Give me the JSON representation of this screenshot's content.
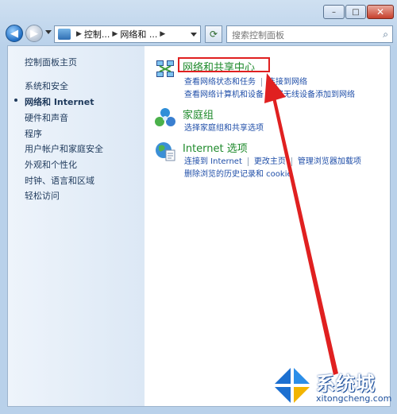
{
  "window": {
    "controls": {
      "minimize": "–",
      "maximize": "□",
      "close": "✕"
    }
  },
  "toolbar": {
    "back_glyph": "◀",
    "forward_glyph": "▶",
    "address": {
      "segments": [
        "控制...",
        "网络和 ..."
      ]
    },
    "refresh_glyph": "⟳",
    "search": {
      "placeholder": "搜索控制面板",
      "icon": "search-icon"
    }
  },
  "sidebar": {
    "home": "控制面板主页",
    "items": [
      {
        "label": "系统和安全",
        "active": false
      },
      {
        "label": "网络和 Internet",
        "active": true
      },
      {
        "label": "硬件和声音",
        "active": false
      },
      {
        "label": "程序",
        "active": false
      },
      {
        "label": "用户帐户和家庭安全",
        "active": false
      },
      {
        "label": "外观和个性化",
        "active": false
      },
      {
        "label": "时钟、语言和区域",
        "active": false
      },
      {
        "label": "轻松访问",
        "active": false
      }
    ]
  },
  "categories": [
    {
      "title": "网络和共享中心",
      "icon": "network-icon",
      "links_row1": [
        "查看网络状态和任务",
        "连接到网络"
      ],
      "links_row2": [
        "查看网络计算机和设备",
        "将无线设备添加到网络"
      ]
    },
    {
      "title": "家庭组",
      "icon": "homegroup-icon",
      "links_row1": [
        "选择家庭组和共享选项"
      ]
    },
    {
      "title": "Internet 选项",
      "icon": "internet-options-icon",
      "links_row1": [
        "连接到 Internet",
        "更改主页",
        "管理浏览器加载项"
      ],
      "links_row2": [
        "删除浏览的历史记录和 cookie"
      ]
    }
  ],
  "watermark": {
    "brand": "系统城",
    "url": "xitongcheng.com"
  },
  "colors": {
    "highlight": "#e02020",
    "category_title": "#1e8a2b",
    "link": "#1f4ea8"
  }
}
